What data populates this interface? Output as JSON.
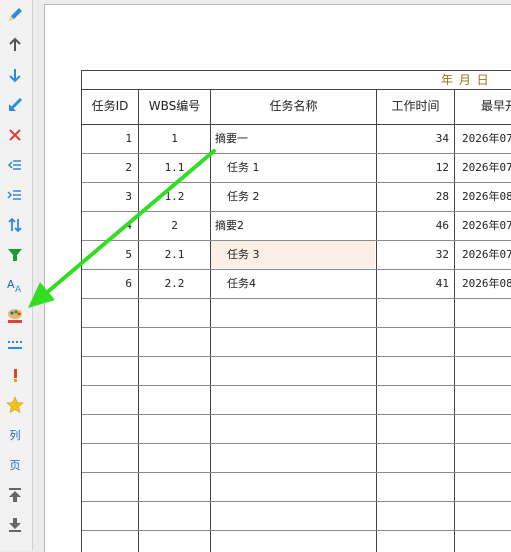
{
  "toolbar": {
    "items": [
      {
        "icon": "pencil-icon"
      },
      {
        "icon": "arrow-up-icon"
      },
      {
        "icon": "arrow-down-icon"
      },
      {
        "icon": "arrow-down-left-icon"
      },
      {
        "icon": "close-icon"
      },
      {
        "icon": "outdent-icon"
      },
      {
        "icon": "indent-icon"
      },
      {
        "icon": "swap-vertical-icon"
      },
      {
        "icon": "filter-icon"
      },
      {
        "icon": "font-color-icon"
      },
      {
        "icon": "palette-icon"
      },
      {
        "icon": "line-style-icon"
      },
      {
        "icon": "exclamation-icon"
      },
      {
        "icon": "star-icon"
      },
      {
        "label": "列",
        "icon": "column-text-icon"
      },
      {
        "label": "页",
        "icon": "page-text-icon"
      },
      {
        "icon": "move-top-icon"
      },
      {
        "icon": "move-bottom-icon"
      }
    ]
  },
  "header_date": "年 月 日",
  "table": {
    "columns": [
      "任务ID",
      "WBS编号",
      "任务名称",
      "工作时间",
      "最早开"
    ],
    "rows": [
      {
        "id": "1",
        "wbs": "1",
        "name": "摘要一",
        "work": "34",
        "start": "2026年07"
      },
      {
        "id": "2",
        "wbs": "1.1",
        "name": "任务 1",
        "work": "12",
        "start": "2026年07"
      },
      {
        "id": "3",
        "wbs": "1.2",
        "name": "任务 2",
        "work": "28",
        "start": "2026年08"
      },
      {
        "id": "4",
        "wbs": "2",
        "name": "摘要2",
        "work": "46",
        "start": "2026年07"
      },
      {
        "id": "5",
        "wbs": "2.1",
        "name": "任务 3",
        "work": "32",
        "start": "2026年07"
      },
      {
        "id": "6",
        "wbs": "2.2",
        "name": "任务4",
        "work": "41",
        "start": "2026年08"
      }
    ]
  },
  "colors": {
    "accent_arrow": "#33dd22",
    "highlight_row": "#fcf0e6"
  }
}
